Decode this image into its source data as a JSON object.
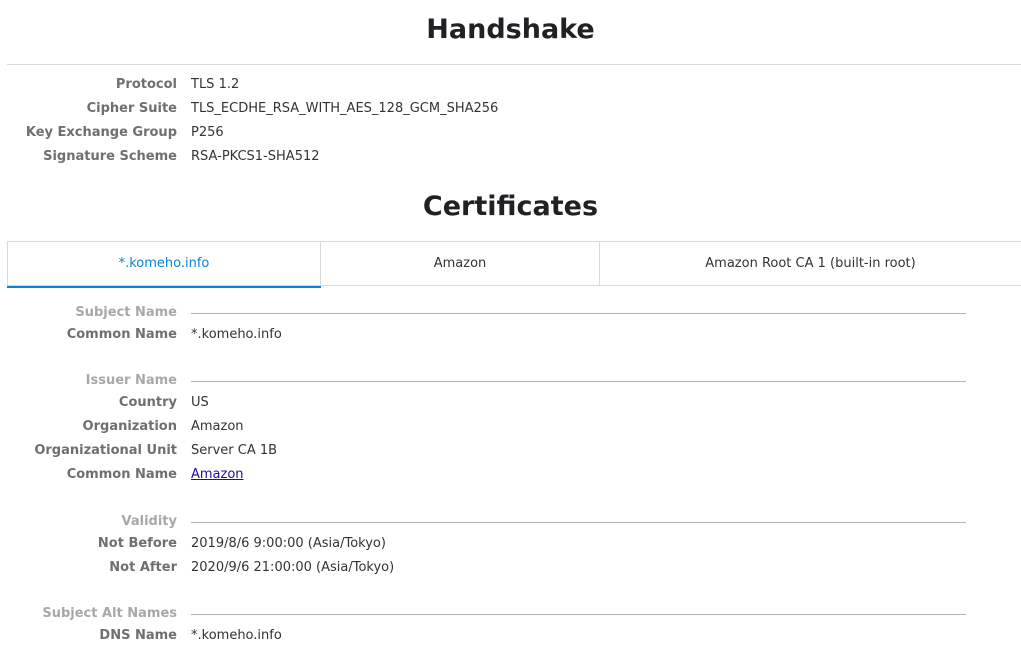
{
  "handshake": {
    "title": "Handshake",
    "rows": [
      {
        "label": "Protocol",
        "value": "TLS 1.2"
      },
      {
        "label": "Cipher Suite",
        "value": "TLS_ECDHE_RSA_WITH_AES_128_GCM_SHA256"
      },
      {
        "label": "Key Exchange Group",
        "value": "P256"
      },
      {
        "label": "Signature Scheme",
        "value": "RSA-PKCS1-SHA512"
      }
    ]
  },
  "certificates": {
    "title": "Certificates",
    "tabs": [
      {
        "label": "*.komeho.info",
        "active": true
      },
      {
        "label": "Amazon",
        "active": false
      },
      {
        "label": "Amazon Root CA 1 (built-in root)",
        "active": false
      }
    ],
    "subject_name": {
      "heading": "Subject Name",
      "common_name_label": "Common Name",
      "common_name": "*.komeho.info"
    },
    "issuer_name": {
      "heading": "Issuer Name",
      "rows": [
        {
          "label": "Country",
          "value": "US"
        },
        {
          "label": "Organization",
          "value": "Amazon"
        },
        {
          "label": "Organizational Unit",
          "value": "Server CA 1B"
        }
      ],
      "common_name_label": "Common Name",
      "common_name_link": "Amazon"
    },
    "validity": {
      "heading": "Validity",
      "not_before_label": "Not Before",
      "not_before": "2019/8/6 9:00:00 (Asia/Tokyo)",
      "not_after_label": "Not After",
      "not_after": "2020/9/6 21:00:00 (Asia/Tokyo)"
    },
    "subject_alt_names": {
      "heading": "Subject Alt Names",
      "dns_name_label": "DNS Name",
      "dns_name": "*.komeho.info"
    }
  },
  "colors": {
    "accent": "#0a84d6",
    "link": "#1a0dab",
    "label": "#6f6f6f",
    "section_label": "#a8a8a8"
  }
}
